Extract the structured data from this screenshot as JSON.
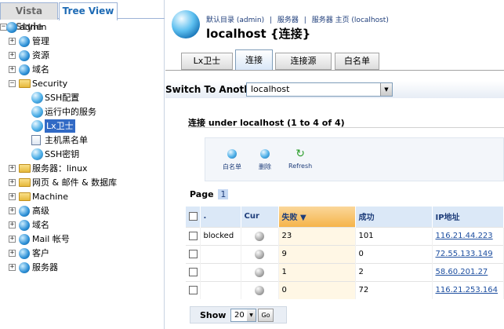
{
  "left_panel": {
    "tabs": [
      {
        "label": "Vista Style",
        "active": false
      },
      {
        "label": "Tree View",
        "active": true
      }
    ],
    "tree": [
      {
        "label": "admin",
        "icon": "user-globe-icon",
        "expander": "minus",
        "depth": 0
      },
      {
        "label": "管理",
        "icon": "admin-icon",
        "expander": "plus",
        "depth": 1
      },
      {
        "label": "资源",
        "icon": "resources-icon",
        "expander": "plus",
        "depth": 1
      },
      {
        "label": "域名",
        "icon": "globe-icon",
        "expander": "plus",
        "depth": 1
      },
      {
        "label": "Security",
        "icon": "folder-open-icon",
        "expander": "minus",
        "depth": 1
      },
      {
        "label": "SSH配置",
        "icon": "ball-icon",
        "expander": "",
        "depth": 2
      },
      {
        "label": "运行中的服务",
        "icon": "ball-icon",
        "expander": "",
        "depth": 2
      },
      {
        "label": "Lx卫士",
        "icon": "ball-icon",
        "expander": "",
        "depth": 2,
        "selected": true
      },
      {
        "label": "主机黑名单",
        "icon": "list-icon",
        "expander": "",
        "depth": 2
      },
      {
        "label": "SSH密钥",
        "icon": "ball-icon",
        "expander": "",
        "depth": 2
      },
      {
        "label": "服务器：linux",
        "icon": "folder-icon",
        "expander": "plus",
        "depth": 1
      },
      {
        "label": "网页 & 邮件 & 数据库",
        "icon": "folder-icon",
        "expander": "plus",
        "depth": 1
      },
      {
        "label": "Machine",
        "icon": "folder-icon",
        "expander": "plus",
        "depth": 1
      },
      {
        "label": "高级",
        "icon": "globe-icon",
        "expander": "plus",
        "depth": 1
      },
      {
        "label": "域名",
        "icon": "globe-icon",
        "expander": "plus",
        "depth": 1
      },
      {
        "label": "Mail 帐号",
        "icon": "mail-icon",
        "expander": "plus",
        "depth": 1
      },
      {
        "label": "客户",
        "icon": "clients-icon",
        "expander": "plus",
        "depth": 1
      },
      {
        "label": "服务器",
        "icon": "server-icon",
        "expander": "plus",
        "depth": 1
      }
    ]
  },
  "header": {
    "breadcrumb": [
      "默认目录 (admin)",
      "|",
      "服务器",
      "|",
      "服务器 主页 (localhost)"
    ],
    "title": "localhost {连接}"
  },
  "content_tabs": [
    {
      "label": "Lx卫士",
      "active": false
    },
    {
      "label": "连接",
      "active": true
    },
    {
      "label": "连接源",
      "active": false
    },
    {
      "label": "白名单",
      "active": false
    }
  ],
  "switch": {
    "label": "Switch To Another",
    "selected": "localhost"
  },
  "list": {
    "title": "连接 under localhost (1 to 4 of 4)",
    "toolbar": [
      {
        "label": "白名单",
        "icon": "ball-icon"
      },
      {
        "label": "删除",
        "icon": "ball-icon"
      },
      {
        "label": "Refresh",
        "icon": "refresh-icon"
      }
    ],
    "page_label": "Page",
    "page_number": "1",
    "columns": [
      ".",
      "Cur",
      "失败",
      "成功",
      "IP地址"
    ],
    "sort_indicator": "▼",
    "rows": [
      {
        "status": "blocked",
        "fail": "23",
        "success": "101",
        "ip": "116.21.44.223"
      },
      {
        "status": "",
        "fail": "9",
        "success": "0",
        "ip": "72.55.133.149"
      },
      {
        "status": "",
        "fail": "1",
        "success": "2",
        "ip": "58.60.201.27"
      },
      {
        "status": "",
        "fail": "0",
        "success": "72",
        "ip": "116.21.253.164"
      }
    ],
    "show_label": "Show",
    "show_value": "20",
    "go_label": "Go"
  }
}
